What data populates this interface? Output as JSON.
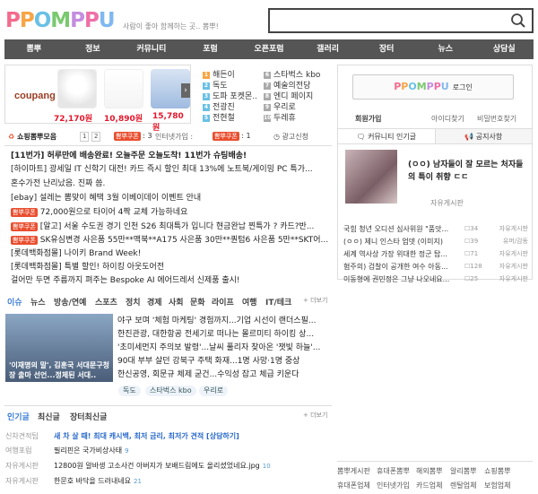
{
  "header": {
    "logo_letters": [
      "P",
      "P",
      "O",
      "M",
      "P",
      "P",
      "U"
    ],
    "slogan": "사람이 좋아 함께하는 곳.. 뽐뿌!",
    "search_placeholder": ""
  },
  "nav": [
    "뽐뿌",
    "정보",
    "커뮤니티",
    "포럼",
    "오픈포럼",
    "갤러리",
    "장터",
    "뉴스",
    "상담실"
  ],
  "ad": {
    "brand": "coupang",
    "prices": [
      "72,170원",
      "10,890원",
      "15,780원"
    ]
  },
  "links": [
    {
      "label": "해든이",
      "color": "#f7a546"
    },
    {
      "label": "독도",
      "color": "#69c0e6"
    },
    {
      "label": "도파 포켓몬..",
      "color": "#69c0e6"
    },
    {
      "label": "전광진",
      "color": "#69c0e6"
    },
    {
      "label": "전현철",
      "color": "#69c0e6"
    },
    {
      "label": "스타벅스 kbo",
      "color": "#aaa"
    },
    {
      "label": "예술의전당",
      "color": "#aaa"
    },
    {
      "label": "엔디 페이지",
      "color": "#aaa"
    },
    {
      "label": "우리로",
      "color": "#aaa"
    },
    {
      "label": "두레휴",
      "color": "#aaa"
    }
  ],
  "shopbar": {
    "title": "쇼핑뽐뿌모음",
    "pages": [
      "1",
      "2"
    ],
    "pill1": "뽐뿌쿠폰",
    "count1": "3",
    "item2": "인터넷가입",
    "pill3": "뽐뿌쿠폰",
    "count3": "1",
    "ad_apply": "광고신청"
  },
  "deals": [
    {
      "pill": "",
      "text": "[11번가] 허루만에 배송완료! 오늘주문 오늘도착! 11번가 슈팅배송!",
      "bold": true
    },
    {
      "pill": "",
      "text": "[하이마트] 광세일 IT 신학기 대전! 카드 즉시 할인 최대 13%에 노트북/게이밍 PC 특가..."
    },
    {
      "pill": "",
      "text": "혼수가전 난리났음. 진짜 씀."
    },
    {
      "pill": "",
      "text": "[ebay] 설레는 뽐맞이 혜택 3월 이베이데이 이벤트 안내"
    },
    {
      "pill": "뽐뿌쿠폰",
      "text": "72,000원으로 타이어 4짝 교체 가능하네요"
    },
    {
      "pill": "뽐뿌쿠폰",
      "text": "[알고] 서울 수도권 경기 인천 S26 최대특가 입니다 현금완납 찐특가 ? 카드?반..."
    },
    {
      "pill": "뽐뿌쿠폰",
      "text": "SK유심변경 사은품 55만**맥북**A175 사은품 30만**퀀텀6 사은품 5만**SKT어..."
    },
    {
      "pill": "",
      "text": "[롯데백화점몰] 나이키 Brand Week!"
    },
    {
      "pill": "",
      "text": "[롯데백화점몰] 특별 할인! 하이킹 아웃도어전"
    },
    {
      "pill": "",
      "text": "걸어만 두면 주름까지 펴주는 Bespoke AI 에어드레서 신제품 출시!"
    }
  ],
  "news": {
    "tabs": [
      "이슈",
      "뉴스",
      "방송/연예",
      "스포츠",
      "정치",
      "경제",
      "사회",
      "문화",
      "라이프",
      "여행",
      "IT/테크"
    ],
    "more": "+ 더보기",
    "image_caption": "'이재명의 말', 김훈국 서대문구청장 출마 선언...정체된 서대..",
    "items": [
      "야구 보며 '체험 마케팅' 경험까지...기업 시선이 랜더스필...",
      "한진관광, 대한항공 전세기로 떠나는 몰르미티 하이킹 상...",
      "'초미세먼지 주의보 발령'...날씨 풀리자 찾아온 '잿빛 하늘'...",
      "90대 부부 살던 강북구 주택 화재...1명 사망·1명 중상",
      "한신공영, 회문규 체제 굳건...수익성 잡고 체급 키운다"
    ],
    "tags": [
      "독도",
      "스타벅스 kbo",
      "우리로"
    ]
  },
  "hot": {
    "tabs": [
      "인기글",
      "최신글",
      "장터최신글"
    ],
    "more": "+ 더보기",
    "rows": [
      {
        "cat": "신차견적팁",
        "text": "새 차 살 때! 최대 캐시백, 최저 금리, 최저가 견적 [상담하기]",
        "cnt": "",
        "highlight": true
      },
      {
        "cat": "여행포럼",
        "text": "필리핀은 국가비상사태",
        "cnt": "9"
      },
      {
        "cat": "자유게시판",
        "text": "12800원 알바생 고소사건 아버지가 보배드림에도 올리셨었네요.jpg",
        "cnt": "10"
      },
      {
        "cat": "자유게시판",
        "text": "한문호 바닥을 드러내네요",
        "cnt": "21"
      }
    ]
  },
  "login": {
    "logo_letters": [
      "P",
      "P",
      "O",
      "M",
      "P",
      "P",
      "U"
    ],
    "login_label": "로그인",
    "signup": "회원가입",
    "find_id": "아이디찾기",
    "find_pw": "비밀번호찾기",
    "tab_popular": "커뮤니티 인기글",
    "tab_notice": "공지사항",
    "featured_title": "(ㅇㅇ) 남자들이 잘 모르는 처자들의 특이 취향 ㄷㄷ",
    "featured_board": "자유게시판",
    "rows": [
      {
        "text": "국힘 청년 오디션 심사위원 \"품앗...",
        "cnt": "34",
        "board": "자유게시판"
      },
      {
        "text": "(ㅇㅇ) 제니 인스타 업뎃 (이미지)",
        "cnt": "39",
        "board": "유머/감동"
      },
      {
        "text": "세계 역사상 가장 위대한 정군 탑...",
        "cnt": "71",
        "board": "자유게시판"
      },
      {
        "text": "혐주의) 검찰이 공개한 여수 아동...",
        "cnt": "128",
        "board": "자유게시판"
      },
      {
        "text": "이동형에 권민정은 그냥 나오네요...",
        "cnt": "25",
        "board": "자유게시판"
      }
    ]
  },
  "bottom_links": [
    "뽐뿌게시판",
    "휴대폰뽐뿌",
    "해외뽐뿌",
    "알리뽐뿌",
    "쇼핑뽐뿌",
    "휴대폰업체",
    "인터넷가입",
    "카드업체",
    "렌탈업체",
    "보험업체"
  ]
}
